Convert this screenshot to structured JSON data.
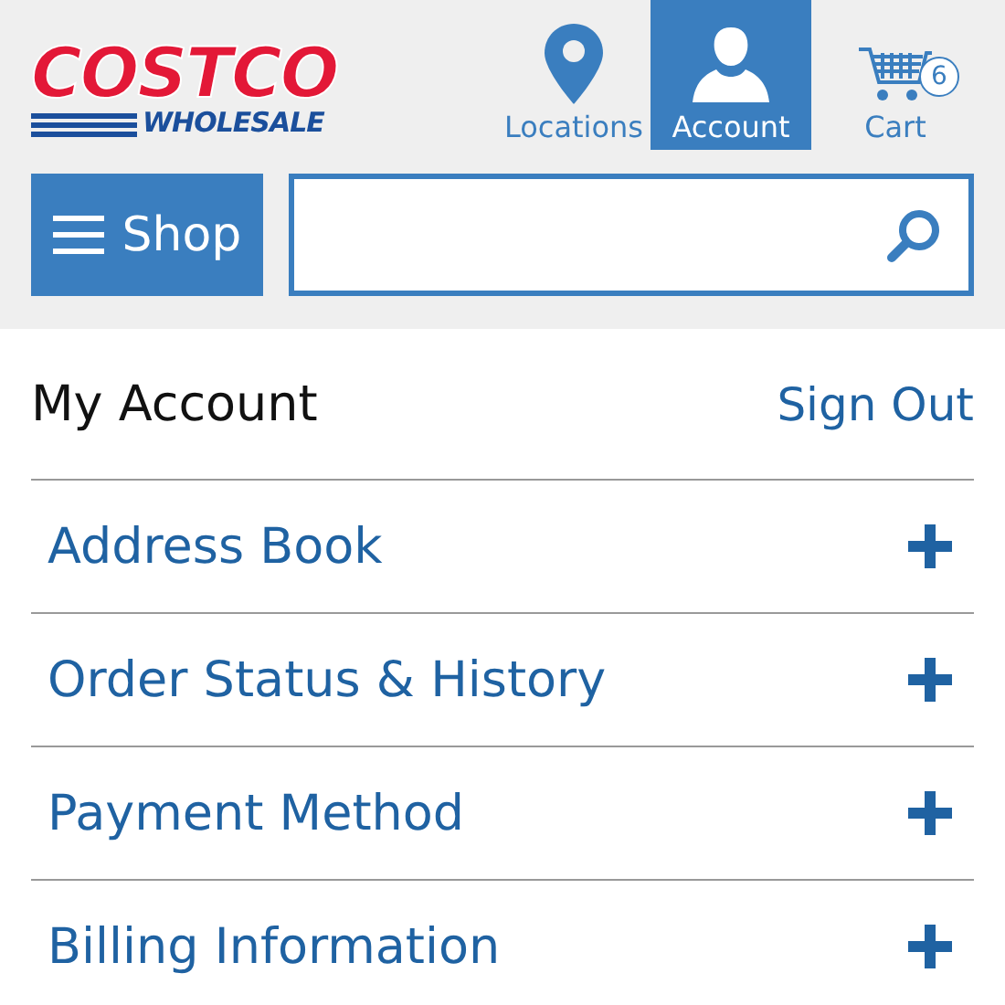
{
  "logo": {
    "top": "COSTCO",
    "bottom": "WHOLESALE"
  },
  "nav": [
    {
      "kind": "location",
      "label": "Locations",
      "selected": false
    },
    {
      "kind": "account",
      "label": "Account",
      "selected": true
    },
    {
      "kind": "cart",
      "label": "Cart",
      "selected": false,
      "badge": "6"
    }
  ],
  "shop_button": {
    "label": "Shop"
  },
  "account": {
    "title": "My Account",
    "sign_out": "Sign Out",
    "sections": [
      {
        "label": "Address Book",
        "expanded": false
      },
      {
        "label": "Order Status & History",
        "expanded": false
      },
      {
        "label": "Payment Method",
        "expanded": false
      },
      {
        "label": "Billing Information",
        "expanded": false
      }
    ]
  }
}
